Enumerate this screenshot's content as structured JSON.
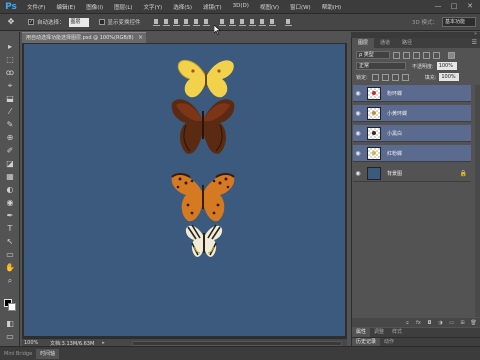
{
  "app": {
    "logo": "Ps"
  },
  "menu": [
    "文件(F)",
    "编辑(E)",
    "图像(I)",
    "图层(L)",
    "文字(Y)",
    "选择(S)",
    "滤镜(T)",
    "3D(D)",
    "视图(V)",
    "窗口(W)",
    "帮助(H)"
  ],
  "window_controls": [
    "—",
    "□",
    "✕"
  ],
  "options": {
    "tool_icon": "move-tool-icon",
    "auto_select_label": "自动选择：",
    "auto_select_value": "图层",
    "show_transform_label": "显示变换控件",
    "mode_3d_label": "3D 模式：",
    "workspace": "基本功能"
  },
  "document": {
    "tab_title": "用自动选择功能选择图层.psd @ 100%(RGB/8)",
    "tab_close": "×",
    "zoom": "100%",
    "doc_info": "文档:3.13M/6.63M",
    "canvas_color": "#3b5a7d"
  },
  "tools": [
    "▸",
    "⬚",
    "ꝏ",
    "⌖",
    "⬓",
    "⁄",
    "✎",
    "⊕",
    "✐",
    "◪",
    "▦",
    "◐",
    "◉",
    "✒",
    "T",
    "↖",
    "▭",
    "✋",
    "⌕",
    "◧"
  ],
  "panels": {
    "top_tabs": [
      "图层",
      "通道",
      "路径"
    ],
    "kind_label": "ρ 类型",
    "blend_mode": "正常",
    "opacity_label": "不透明度:",
    "opacity_value": "100%",
    "lock_label": "锁定:",
    "fill_label": "填充:",
    "fill_value": "100%",
    "layers": [
      {
        "name": "粉环蝶",
        "selected": true,
        "thumb": "#b33"
      },
      {
        "name": "小黄环蝶",
        "selected": true,
        "thumb": "#c8902a"
      },
      {
        "name": "小黑白",
        "selected": true,
        "thumb": "#3a2a1a"
      },
      {
        "name": "红粉蝶",
        "selected": true,
        "thumb": "#d9b23a"
      },
      {
        "name": "背景图",
        "selected": false,
        "thumb": "bg",
        "lock": "🔒"
      }
    ],
    "footer_icons": [
      "ɕ",
      "fx",
      "◘",
      "◑",
      "▭",
      "⊞",
      "🗑"
    ],
    "bottom_tabs_1": [
      "属性",
      "调整",
      "样式"
    ],
    "bottom_tabs_2": [
      "历史记录",
      "动作"
    ]
  },
  "bottombar": {
    "tabs": [
      "Mini Bridge",
      "时间轴"
    ]
  }
}
